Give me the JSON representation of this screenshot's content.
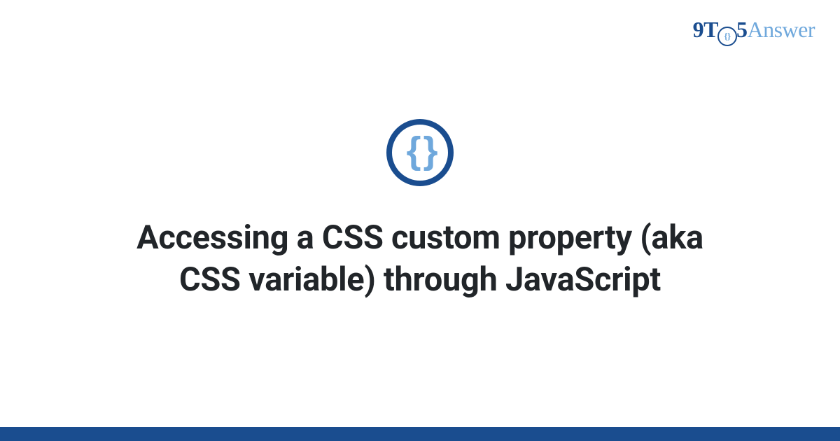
{
  "brand": {
    "part9t": "9T",
    "innerBraces": "{}",
    "part5": "5",
    "answer": "Answer"
  },
  "icon": {
    "symbol": "{ }"
  },
  "headline": "Accessing a CSS custom property (aka CSS variable) through JavaScript"
}
